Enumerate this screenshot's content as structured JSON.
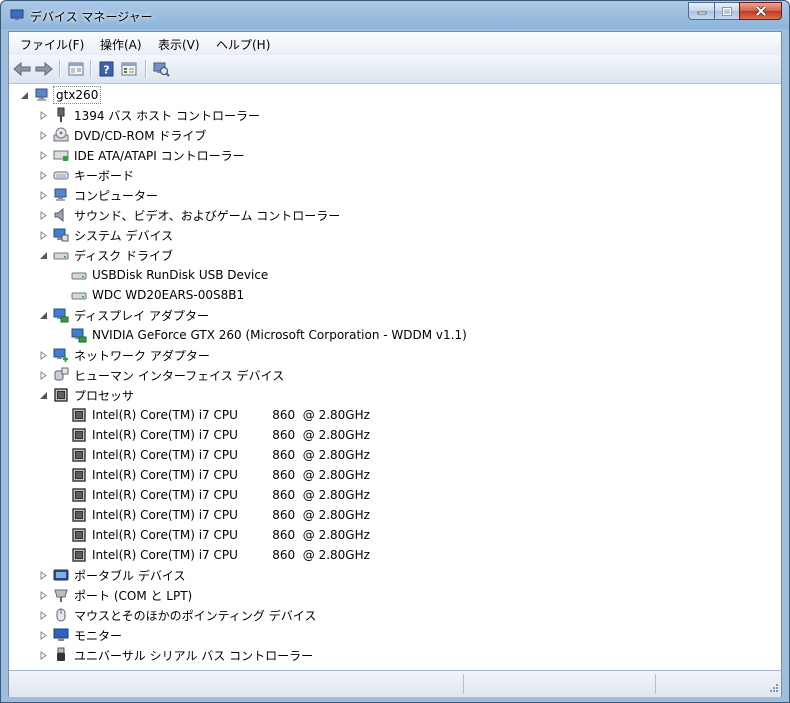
{
  "window": {
    "title": "デバイス マネージャー",
    "colors": {
      "title_bar": "#9dbedf",
      "close_button": "#c2371c"
    }
  },
  "menu": [
    "ファイル(F)",
    "操作(A)",
    "表示(V)",
    "ヘルプ(H)"
  ],
  "toolbar": [
    "back-arrow-icon",
    "forward-arrow-icon",
    "properties-list-icon",
    "help-icon",
    "details-view-icon",
    "scan-hardware-icon"
  ],
  "tree": {
    "root": {
      "label": "gtx260",
      "icon": "computer-icon"
    },
    "items": [
      {
        "label": "1394 バス ホスト コントローラー",
        "icon": "plug-icon",
        "expanded": false
      },
      {
        "label": "DVD/CD-ROM ドライブ",
        "icon": "optical-drive-icon",
        "expanded": false
      },
      {
        "label": "IDE ATA/ATAPI コントローラー",
        "icon": "controller-icon",
        "expanded": false
      },
      {
        "label": "キーボード",
        "icon": "keyboard-icon",
        "expanded": false
      },
      {
        "label": "コンピューター",
        "icon": "computer-icon",
        "expanded": false
      },
      {
        "label": "サウンド、ビデオ、およびゲーム コントローラー",
        "icon": "speaker-icon",
        "expanded": false
      },
      {
        "label": "システム デバイス",
        "icon": "system-device-icon",
        "expanded": false
      },
      {
        "label": "ディスク ドライブ",
        "icon": "disk-drive-icon",
        "expanded": true,
        "children": [
          {
            "label": "USBDisk RunDisk USB Device",
            "icon": "disk-drive-icon"
          },
          {
            "label": "WDC WD20EARS-00S8B1",
            "icon": "disk-drive-icon"
          }
        ]
      },
      {
        "label": "ディスプレイ アダプター",
        "icon": "display-adapter-icon",
        "expanded": true,
        "children": [
          {
            "label": "NVIDIA GeForce GTX 260 (Microsoft Corporation - WDDM v1.1)",
            "icon": "display-adapter-icon"
          }
        ]
      },
      {
        "label": "ネットワーク アダプター",
        "icon": "network-adapter-icon",
        "expanded": false
      },
      {
        "label": "ヒューマン インターフェイス デバイス",
        "icon": "hid-icon",
        "expanded": false
      },
      {
        "label": "プロセッサ",
        "icon": "processor-icon",
        "expanded": true,
        "children": [
          {
            "label": "Intel(R) Core(TM) i7 CPU         860  @ 2.80GHz",
            "icon": "processor-icon"
          },
          {
            "label": "Intel(R) Core(TM) i7 CPU         860  @ 2.80GHz",
            "icon": "processor-icon"
          },
          {
            "label": "Intel(R) Core(TM) i7 CPU         860  @ 2.80GHz",
            "icon": "processor-icon"
          },
          {
            "label": "Intel(R) Core(TM) i7 CPU         860  @ 2.80GHz",
            "icon": "processor-icon"
          },
          {
            "label": "Intel(R) Core(TM) i7 CPU         860  @ 2.80GHz",
            "icon": "processor-icon"
          },
          {
            "label": "Intel(R) Core(TM) i7 CPU         860  @ 2.80GHz",
            "icon": "processor-icon"
          },
          {
            "label": "Intel(R) Core(TM) i7 CPU         860  @ 2.80GHz",
            "icon": "processor-icon"
          },
          {
            "label": "Intel(R) Core(TM) i7 CPU         860  @ 2.80GHz",
            "icon": "processor-icon"
          }
        ]
      },
      {
        "label": "ポータブル デバイス",
        "icon": "portable-device-icon",
        "expanded": false
      },
      {
        "label": "ポート (COM と LPT)",
        "icon": "port-icon",
        "expanded": false
      },
      {
        "label": "マウスとそのほかのポインティング デバイス",
        "icon": "mouse-icon",
        "expanded": false
      },
      {
        "label": "モニター",
        "icon": "monitor-icon",
        "expanded": false
      },
      {
        "label": "ユニバーサル シリアル バス コントローラー",
        "icon": "usb-icon",
        "expanded": false
      }
    ]
  },
  "statusbar": {
    "text": ""
  }
}
